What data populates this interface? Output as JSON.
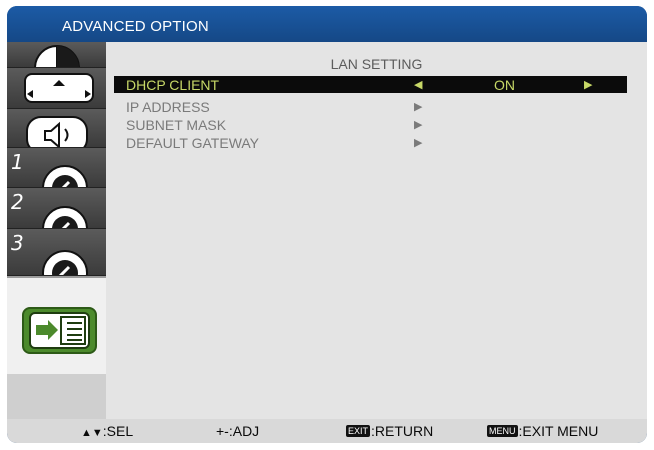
{
  "window": {
    "title": "ADVANCED OPTION"
  },
  "sidebar": {
    "tabs": [
      {
        "icon": "picture-icon",
        "label": ""
      },
      {
        "icon": "screen-adjust-icon",
        "label": ""
      },
      {
        "icon": "audio-icon",
        "label": ""
      },
      {
        "icon": "configuration-icon",
        "label": "1"
      },
      {
        "icon": "configuration-icon",
        "label": "2"
      },
      {
        "icon": "configuration-icon",
        "label": "3"
      },
      {
        "icon": "advanced-option-icon",
        "label": "",
        "selected": true
      }
    ]
  },
  "main": {
    "heading": "LAN SETTING",
    "items": [
      {
        "label": "DHCP CLIENT",
        "left_arrow": "◀",
        "value": "ON",
        "right_arrow": "▶",
        "active": true
      },
      {
        "label": "IP ADDRESS",
        "submenu_arrow": "▶"
      },
      {
        "label": "SUBNET MASK",
        "submenu_arrow": "▶"
      },
      {
        "label": "DEFAULT GATEWAY",
        "submenu_arrow": "▶"
      }
    ]
  },
  "footer": {
    "sel": ":SEL",
    "sel_keys": "▲▼",
    "adj": "+-:ADJ",
    "exit_key": "EXIT",
    "exit_text": ":RETURN",
    "menu_key": "MENU",
    "menu_text": ":EXIT MENU"
  },
  "colors": {
    "title_bar": "#1c5ba6",
    "highlight_text": "#c7d867",
    "icon_green": "#4c8a2c"
  }
}
